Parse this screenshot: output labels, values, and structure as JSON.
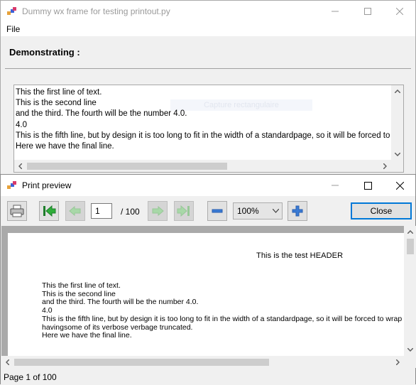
{
  "main_window": {
    "title": "Dummy wx frame for testing printout.py",
    "menu": [
      "File"
    ],
    "demo_label": "Demonstrating :",
    "ghost_text": "Capture rectangulaire",
    "text_lines": [
      "This the first line of text.",
      "This is the second line",
      "and the third. The fourth will be the number 4.0.",
      "4.0",
      "This is the fifth line, but by design it is too long to fit in the width of a standardpage, so it will be forced to wrap around in order to fit without having",
      "Here we have the final line."
    ]
  },
  "preview_window": {
    "title": "Print preview",
    "page_current": "1",
    "page_total": "/ 100",
    "zoom": "100%",
    "close_label": "Close",
    "page_header": "This is the test HEADER",
    "page_lines": [
      "This the first line of text.",
      "This is the second line",
      "and the third. The fourth will be the number 4.0.",
      "4.0",
      "This is the fifth line, but by design it is too long to fit in the width of a standardpage, so it will be forced to wrap",
      "havingsome of its verbose verbage truncated.",
      "Here we have the final line."
    ],
    "status": "Page 1 of 100"
  },
  "colors": {
    "accent": "#0078d7",
    "nav_green": "#2fae3a",
    "zoom_blue": "#3a7bd5"
  },
  "icons": {
    "print": "printer-icon",
    "first": "first-page-icon",
    "prev": "prev-page-icon",
    "next": "next-page-icon",
    "last": "last-page-icon",
    "zoom_out": "zoom-out-icon",
    "zoom_in": "zoom-in-icon"
  }
}
